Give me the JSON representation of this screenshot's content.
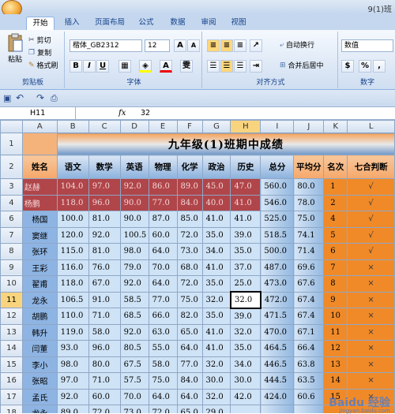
{
  "window": {
    "title": "9(1)班"
  },
  "tabs": [
    "开始",
    "插入",
    "页面布局",
    "公式",
    "数据",
    "审阅",
    "视图"
  ],
  "clipboard": {
    "paste": "粘贴",
    "cut": "剪切",
    "copy": "复制",
    "painter": "格式刷",
    "label": "剪贴板"
  },
  "font": {
    "name": "楷体_GB2312",
    "size": "12",
    "label": "字体",
    "grow": "A",
    "shrink": "A",
    "bold": "B",
    "italic": "I",
    "underline": "U",
    "color": "A",
    "phonetic": "雯"
  },
  "align": {
    "label": "对齐方式",
    "wrap": "自动换行",
    "merge": "合并后居中"
  },
  "number": {
    "format": "数值",
    "label": "数字",
    "percent": "%",
    "comma": ","
  },
  "formula_bar": {
    "cell": "H11",
    "fx": "fx",
    "value": "32"
  },
  "columns": [
    "A",
    "B",
    "C",
    "D",
    "E",
    "F",
    "G",
    "H",
    "I",
    "J",
    "K",
    "L"
  ],
  "sheet": {
    "title": "九年级(1)班期中成绩",
    "headers": [
      "姓名",
      "语文",
      "数学",
      "英语",
      "物理",
      "化学",
      "政治",
      "历史",
      "总分",
      "平均分",
      "名次",
      "七合判断"
    ],
    "rows": [
      {
        "r": "3",
        "cells": [
          "赵赫",
          "104.0",
          "97.0",
          "92.0",
          "86.0",
          "89.0",
          "45.0",
          "47.0",
          "560.0",
          "80.0",
          "1",
          "√"
        ]
      },
      {
        "r": "4",
        "cells": [
          "杨鹏",
          "118.0",
          "96.0",
          "90.0",
          "77.0",
          "84.0",
          "40.0",
          "41.0",
          "546.0",
          "78.0",
          "2",
          "√"
        ]
      },
      {
        "r": "6",
        "cells": [
          "杨国",
          "100.0",
          "81.0",
          "90.0",
          "87.0",
          "85.0",
          "41.0",
          "41.0",
          "525.0",
          "75.0",
          "4",
          "√"
        ]
      },
      {
        "r": "7",
        "cells": [
          "窦继",
          "120.0",
          "92.0",
          "100.5",
          "60.0",
          "72.0",
          "35.0",
          "39.0",
          "518.5",
          "74.1",
          "5",
          "√"
        ]
      },
      {
        "r": "8",
        "cells": [
          "张环",
          "115.0",
          "81.0",
          "98.0",
          "64.0",
          "73.0",
          "34.0",
          "35.0",
          "500.0",
          "71.4",
          "6",
          "√"
        ]
      },
      {
        "r": "9",
        "cells": [
          "王彩",
          "116.0",
          "76.0",
          "79.0",
          "70.0",
          "68.0",
          "41.0",
          "37.0",
          "487.0",
          "69.6",
          "7",
          "×"
        ]
      },
      {
        "r": "10",
        "cells": [
          "翟甫",
          "118.0",
          "67.0",
          "92.0",
          "64.0",
          "72.0",
          "35.0",
          "25.0",
          "473.0",
          "67.6",
          "8",
          "×"
        ]
      },
      {
        "r": "11",
        "cells": [
          "龙永",
          "106.5",
          "91.0",
          "58.5",
          "77.0",
          "75.0",
          "32.0",
          "32.0",
          "472.0",
          "67.4",
          "9",
          "×"
        ]
      },
      {
        "r": "12",
        "cells": [
          "胡鹏",
          "110.0",
          "71.0",
          "68.5",
          "66.0",
          "82.0",
          "35.0",
          "39.0",
          "471.5",
          "67.4",
          "10",
          "×"
        ]
      },
      {
        "r": "13",
        "cells": [
          "韩升",
          "119.0",
          "58.0",
          "92.0",
          "63.0",
          "65.0",
          "41.0",
          "32.0",
          "470.0",
          "67.1",
          "11",
          "×"
        ]
      },
      {
        "r": "14",
        "cells": [
          "闫董",
          "93.0",
          "96.0",
          "80.5",
          "55.0",
          "64.0",
          "41.0",
          "35.0",
          "464.5",
          "66.4",
          "12",
          "×"
        ]
      },
      {
        "r": "15",
        "cells": [
          "李小",
          "98.0",
          "80.0",
          "67.5",
          "58.0",
          "77.0",
          "32.0",
          "34.0",
          "446.5",
          "63.8",
          "13",
          "×"
        ]
      },
      {
        "r": "16",
        "cells": [
          "张昭",
          "97.0",
          "71.0",
          "57.5",
          "75.0",
          "84.0",
          "30.0",
          "30.0",
          "444.5",
          "63.5",
          "14",
          "×"
        ]
      },
      {
        "r": "17",
        "cells": [
          "孟氏",
          "92.0",
          "60.0",
          "70.0",
          "64.0",
          "64.0",
          "32.0",
          "42.0",
          "424.0",
          "60.6",
          "15",
          "×"
        ]
      },
      {
        "r": "18",
        "cells": [
          "龙永",
          "89.0",
          "72.0",
          "73.0",
          "72.0",
          "65.0",
          "29.0",
          "",
          "",
          "",
          "",
          ""
        ]
      }
    ]
  },
  "watermark": {
    "text": "Baidu 经验",
    "url": "jingyan.baidu.com"
  }
}
